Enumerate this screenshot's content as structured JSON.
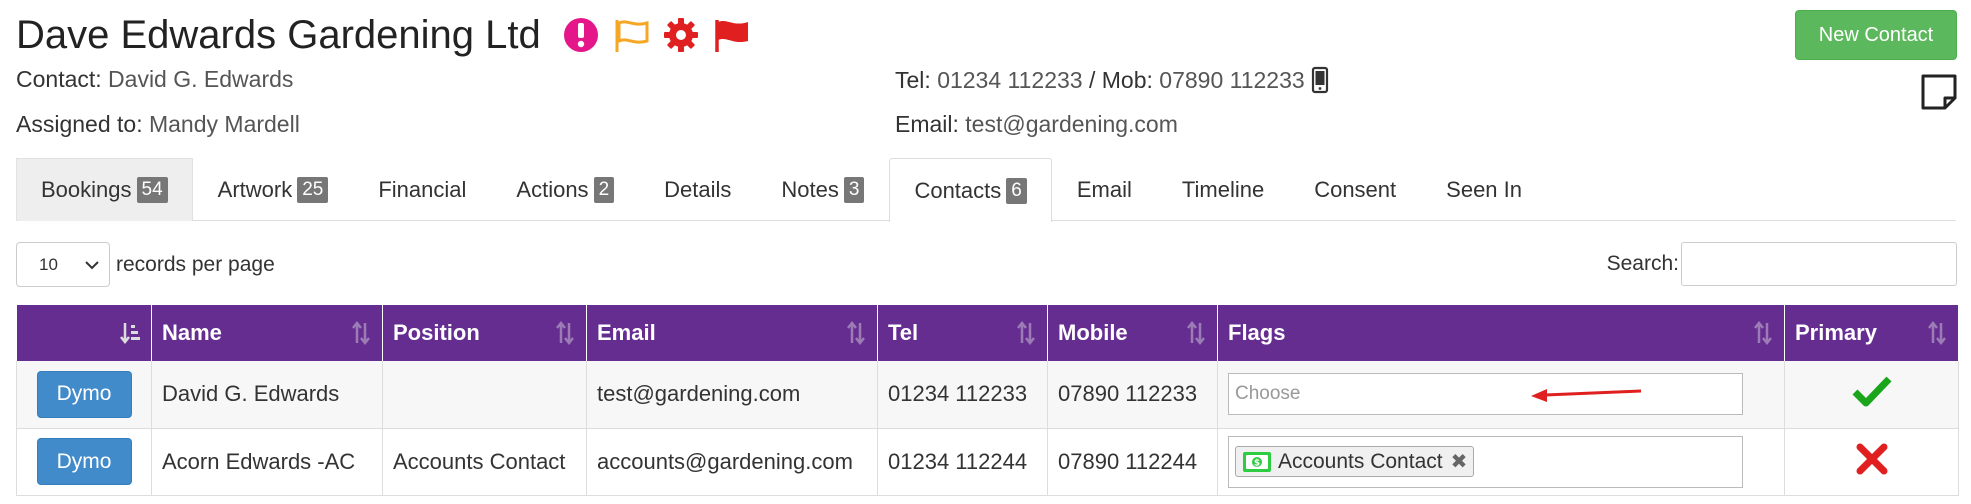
{
  "header": {
    "company_name": "Dave Edwards Gardening Ltd",
    "new_contact_label": "New Contact",
    "contact_label": "Contact:",
    "contact_value": "David G. Edwards",
    "assigned_label": "Assigned to:",
    "assigned_value": "Mandy Mardell",
    "tel_label": "Tel:",
    "tel_value": "01234 112233",
    "separator": "/",
    "mob_label": "Mob:",
    "mob_value": "07890 112233",
    "email_label": "Email:",
    "email_value": "test@gardening.com",
    "icons": [
      "alert-icon",
      "outline-flag-icon",
      "gear-icon",
      "red-flag-icon"
    ]
  },
  "tabs": [
    {
      "label": "Bookings",
      "badge": "54"
    },
    {
      "label": "Artwork",
      "badge": "25"
    },
    {
      "label": "Financial",
      "badge": ""
    },
    {
      "label": "Actions",
      "badge": "2"
    },
    {
      "label": "Details",
      "badge": ""
    },
    {
      "label": "Notes",
      "badge": "3"
    },
    {
      "label": "Contacts",
      "badge": "6"
    },
    {
      "label": "Email",
      "badge": ""
    },
    {
      "label": "Timeline",
      "badge": ""
    },
    {
      "label": "Consent",
      "badge": ""
    },
    {
      "label": "Seen In",
      "badge": ""
    }
  ],
  "controls": {
    "page_length": "10",
    "records_label": "records per page",
    "search_label": "Search:"
  },
  "table": {
    "columns": [
      "",
      "Name",
      "Position",
      "Email",
      "Tel",
      "Mobile",
      "Flags",
      "Primary"
    ],
    "rows": [
      {
        "button": "Dymo",
        "name": "David G. Edwards",
        "position": "",
        "email": "test@gardening.com",
        "tel": "01234 112233",
        "mobile": "07890 112233",
        "flags_placeholder": "Choose",
        "primary": "check"
      },
      {
        "button": "Dymo",
        "name": "Acorn Edwards -AC",
        "position": "Accounts Contact",
        "email": "accounts@gardening.com",
        "tel": "01234 112244",
        "mobile": "07890 112244",
        "flag_chip": "Accounts Contact",
        "primary": "cross"
      }
    ]
  },
  "colors": {
    "header_purple": "#662d91",
    "new_contact_green": "#5cb85c",
    "dymo_blue": "#428bca",
    "alert_magenta": "#e5168a",
    "flag_orange": "#f5a623",
    "red": "#e02020",
    "check_green": "#1aa51a"
  }
}
